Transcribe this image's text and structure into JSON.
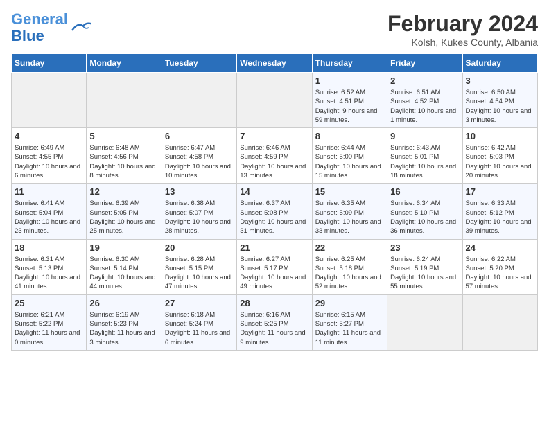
{
  "header": {
    "logo_line1": "General",
    "logo_line2": "Blue",
    "title": "February 2024",
    "subtitle": "Kolsh, Kukes County, Albania"
  },
  "days_of_week": [
    "Sunday",
    "Monday",
    "Tuesday",
    "Wednesday",
    "Thursday",
    "Friday",
    "Saturday"
  ],
  "weeks": [
    [
      {
        "day": "",
        "info": ""
      },
      {
        "day": "",
        "info": ""
      },
      {
        "day": "",
        "info": ""
      },
      {
        "day": "",
        "info": ""
      },
      {
        "day": "1",
        "info": "Sunrise: 6:52 AM\nSunset: 4:51 PM\nDaylight: 9 hours and 59 minutes."
      },
      {
        "day": "2",
        "info": "Sunrise: 6:51 AM\nSunset: 4:52 PM\nDaylight: 10 hours and 1 minute."
      },
      {
        "day": "3",
        "info": "Sunrise: 6:50 AM\nSunset: 4:54 PM\nDaylight: 10 hours and 3 minutes."
      }
    ],
    [
      {
        "day": "4",
        "info": "Sunrise: 6:49 AM\nSunset: 4:55 PM\nDaylight: 10 hours and 6 minutes."
      },
      {
        "day": "5",
        "info": "Sunrise: 6:48 AM\nSunset: 4:56 PM\nDaylight: 10 hours and 8 minutes."
      },
      {
        "day": "6",
        "info": "Sunrise: 6:47 AM\nSunset: 4:58 PM\nDaylight: 10 hours and 10 minutes."
      },
      {
        "day": "7",
        "info": "Sunrise: 6:46 AM\nSunset: 4:59 PM\nDaylight: 10 hours and 13 minutes."
      },
      {
        "day": "8",
        "info": "Sunrise: 6:44 AM\nSunset: 5:00 PM\nDaylight: 10 hours and 15 minutes."
      },
      {
        "day": "9",
        "info": "Sunrise: 6:43 AM\nSunset: 5:01 PM\nDaylight: 10 hours and 18 minutes."
      },
      {
        "day": "10",
        "info": "Sunrise: 6:42 AM\nSunset: 5:03 PM\nDaylight: 10 hours and 20 minutes."
      }
    ],
    [
      {
        "day": "11",
        "info": "Sunrise: 6:41 AM\nSunset: 5:04 PM\nDaylight: 10 hours and 23 minutes."
      },
      {
        "day": "12",
        "info": "Sunrise: 6:39 AM\nSunset: 5:05 PM\nDaylight: 10 hours and 25 minutes."
      },
      {
        "day": "13",
        "info": "Sunrise: 6:38 AM\nSunset: 5:07 PM\nDaylight: 10 hours and 28 minutes."
      },
      {
        "day": "14",
        "info": "Sunrise: 6:37 AM\nSunset: 5:08 PM\nDaylight: 10 hours and 31 minutes."
      },
      {
        "day": "15",
        "info": "Sunrise: 6:35 AM\nSunset: 5:09 PM\nDaylight: 10 hours and 33 minutes."
      },
      {
        "day": "16",
        "info": "Sunrise: 6:34 AM\nSunset: 5:10 PM\nDaylight: 10 hours and 36 minutes."
      },
      {
        "day": "17",
        "info": "Sunrise: 6:33 AM\nSunset: 5:12 PM\nDaylight: 10 hours and 39 minutes."
      }
    ],
    [
      {
        "day": "18",
        "info": "Sunrise: 6:31 AM\nSunset: 5:13 PM\nDaylight: 10 hours and 41 minutes."
      },
      {
        "day": "19",
        "info": "Sunrise: 6:30 AM\nSunset: 5:14 PM\nDaylight: 10 hours and 44 minutes."
      },
      {
        "day": "20",
        "info": "Sunrise: 6:28 AM\nSunset: 5:15 PM\nDaylight: 10 hours and 47 minutes."
      },
      {
        "day": "21",
        "info": "Sunrise: 6:27 AM\nSunset: 5:17 PM\nDaylight: 10 hours and 49 minutes."
      },
      {
        "day": "22",
        "info": "Sunrise: 6:25 AM\nSunset: 5:18 PM\nDaylight: 10 hours and 52 minutes."
      },
      {
        "day": "23",
        "info": "Sunrise: 6:24 AM\nSunset: 5:19 PM\nDaylight: 10 hours and 55 minutes."
      },
      {
        "day": "24",
        "info": "Sunrise: 6:22 AM\nSunset: 5:20 PM\nDaylight: 10 hours and 57 minutes."
      }
    ],
    [
      {
        "day": "25",
        "info": "Sunrise: 6:21 AM\nSunset: 5:22 PM\nDaylight: 11 hours and 0 minutes."
      },
      {
        "day": "26",
        "info": "Sunrise: 6:19 AM\nSunset: 5:23 PM\nDaylight: 11 hours and 3 minutes."
      },
      {
        "day": "27",
        "info": "Sunrise: 6:18 AM\nSunset: 5:24 PM\nDaylight: 11 hours and 6 minutes."
      },
      {
        "day": "28",
        "info": "Sunrise: 6:16 AM\nSunset: 5:25 PM\nDaylight: 11 hours and 9 minutes."
      },
      {
        "day": "29",
        "info": "Sunrise: 6:15 AM\nSunset: 5:27 PM\nDaylight: 11 hours and 11 minutes."
      },
      {
        "day": "",
        "info": ""
      },
      {
        "day": "",
        "info": ""
      }
    ]
  ]
}
